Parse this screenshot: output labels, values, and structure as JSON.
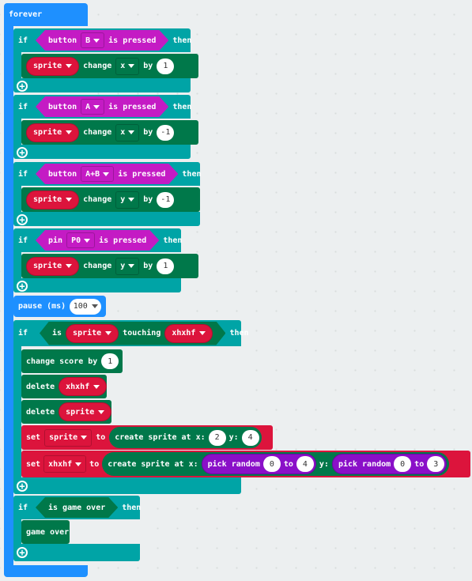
{
  "colors": {
    "forever": "#1e90ff",
    "logic": "#00a4a6",
    "sprite": "#dc143c",
    "input": "#c41bc4",
    "game": "#00784a",
    "math": "#8a10c8"
  },
  "forever": {
    "label": "forever"
  },
  "ifs": [
    {
      "if": "if",
      "cond": {
        "a": "button",
        "b": "B",
        "c": "is pressed"
      },
      "then": "then",
      "body": {
        "sprite": "sprite",
        "change": "change",
        "axis": "x",
        "by": "by",
        "value": "1"
      }
    },
    {
      "if": "if",
      "cond": {
        "a": "button",
        "b": "A",
        "c": "is pressed"
      },
      "then": "then",
      "body": {
        "sprite": "sprite",
        "change": "change",
        "axis": "x",
        "by": "by",
        "value": "-1"
      }
    },
    {
      "if": "if",
      "cond": {
        "a": "button",
        "b": "A+B",
        "c": "is pressed"
      },
      "then": "then",
      "body": {
        "sprite": "sprite",
        "change": "change",
        "axis": "y",
        "by": "by",
        "value": "-1"
      }
    },
    {
      "if": "if",
      "cond": {
        "a": "pin",
        "b": "P0",
        "c": "is pressed"
      },
      "then": "then",
      "body": {
        "sprite": "sprite",
        "change": "change",
        "axis": "y",
        "by": "by",
        "value": "1"
      }
    }
  ],
  "pause": {
    "label": "pause (ms)",
    "value": "100"
  },
  "touch_if": {
    "if": "if",
    "is": "is",
    "a": "sprite",
    "touching": "touching",
    "b": "xhxhf",
    "then": "then",
    "change_score": "change score by",
    "score_value": "1",
    "delete1": "delete",
    "delete1_target": "xhxhf",
    "delete2": "delete",
    "delete2_target": "sprite",
    "set1": {
      "set": "set",
      "var": "sprite",
      "to": "to",
      "create": "create sprite at x:",
      "x": "2",
      "y_label": "y:",
      "y": "4"
    },
    "set2": {
      "set": "set",
      "var": "xhxhf",
      "to": "to",
      "create": "create sprite at x:",
      "pick1": "pick random",
      "p1a": "0",
      "p1to": "to",
      "p1b": "4",
      "y_label": "y:",
      "pick2": "pick random",
      "p2a": "0",
      "p2to": "to",
      "p2b": "3"
    }
  },
  "gameover_if": {
    "if": "if",
    "cond": "is game over",
    "then": "then",
    "body": "game over"
  }
}
